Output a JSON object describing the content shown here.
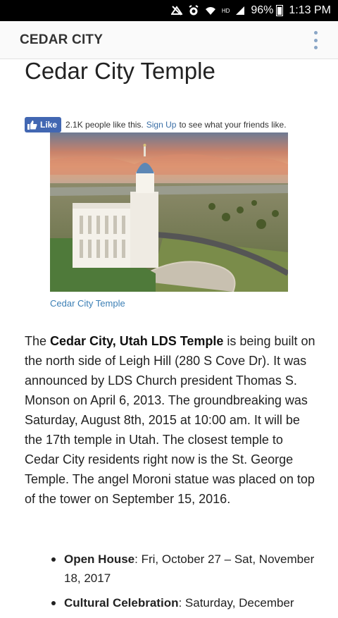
{
  "status": {
    "time": "1:13 PM",
    "battery": "96%",
    "icons": [
      "signal-cut-icon",
      "alarm-icon",
      "wifi-icon",
      "hd-icon",
      "cell-signal-icon",
      "battery-icon"
    ]
  },
  "appbar": {
    "title": "CEDAR CITY",
    "menu_icon": "more-vert-icon"
  },
  "article": {
    "title": "Cedar City Temple",
    "like": {
      "button_label": "Like",
      "count_text": "2.1K people like this.",
      "signup_label": "Sign Up",
      "suffix_text": "to see what your friends like."
    },
    "image_caption": "Cedar City Temple",
    "paragraph": {
      "pre": "The ",
      "bold": "Cedar City, Utah LDS Temple",
      "rest": " is being built on the north side of Leigh Hill (280 S Cove Dr). It was announced by LDS Church president Thomas S. Monson on April 6, 2013. The groundbreaking was Saturday, August 8th, 2015 at 10:00 am. It will be the 17th temple in Utah. The closest temple to Cedar City residents right now is the St. George Temple. The angel Moroni statue was placed on top of the tower on September 15, 2016."
    },
    "events": [
      {
        "label": "Open House",
        "value": ": Fri, October 27 – Sat, November 18, 2017"
      },
      {
        "label": "Cultural Celebration",
        "value": ": Saturday, December"
      }
    ]
  },
  "colors": {
    "like_blue": "#4267b2",
    "link_blue": "#3b7fb5",
    "status_bg": "#000000"
  }
}
